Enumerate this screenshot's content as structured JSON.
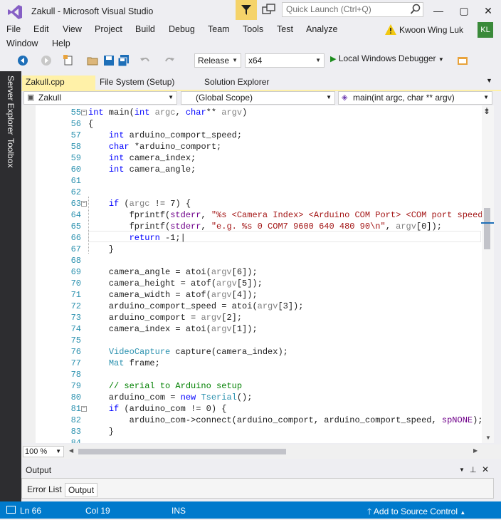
{
  "window": {
    "title": "Zakull - Microsoft Visual Studio",
    "quick_launch_placeholder": "Quick Launch (Ctrl+Q)",
    "minimize": "—",
    "maximize": "▢",
    "close": "✕"
  },
  "menu": [
    "File",
    "Edit",
    "View",
    "Project",
    "Build",
    "Debug",
    "Team",
    "Tools",
    "Test",
    "Analyze",
    "Window",
    "Help"
  ],
  "user": {
    "name": "Kwoon Wing Luk",
    "initials": "KL"
  },
  "toolbar": {
    "configuration": "Release",
    "platform": "x64",
    "debugger": "Local Windows Debugger"
  },
  "side_tabs": {
    "server_explorer": "Server Explorer",
    "toolbox": "Toolbox"
  },
  "tabs": [
    "Zakull.cpp",
    "File System (Setup)",
    "Solution Explorer"
  ],
  "nav": {
    "project": "Zakull",
    "scope": "(Global Scope)",
    "member": "main(int argc, char ** argv)"
  },
  "code_lines": [
    {
      "n": "55",
      "fold": "−",
      "html": "<span class=\"kw\">int</span> main(<span class=\"kw\">int</span> <span class=\"pm\">argc</span>, <span class=\"kw\">char</span>** <span class=\"pm\">argv</span>)"
    },
    {
      "n": "56",
      "fold": "",
      "html": "{"
    },
    {
      "n": "57",
      "fold": "",
      "html": "    <span class=\"kw\">int</span> arduino_comport_speed;"
    },
    {
      "n": "58",
      "fold": "",
      "html": "    <span class=\"kw\">char</span> *arduino_comport;"
    },
    {
      "n": "59",
      "fold": "",
      "html": "    <span class=\"kw\">int</span> camera_index;"
    },
    {
      "n": "60",
      "fold": "",
      "html": "    <span class=\"kw\">int</span> camera_angle;"
    },
    {
      "n": "61",
      "fold": "",
      "html": ""
    },
    {
      "n": "62",
      "fold": "",
      "html": ""
    },
    {
      "n": "63",
      "fold": "−",
      "html": "    <span class=\"kw\">if</span> (<span class=\"pm\">argc</span> != 7) {"
    },
    {
      "n": "64",
      "fold": "",
      "html": "        fprintf(<span class=\"mc\">stderr</span>, <span class=\"st\">\"%s &lt;Camera Index&gt; &lt;Arduino COM Port&gt; &lt;COM port speed&gt;</span>"
    },
    {
      "n": "65",
      "fold": "",
      "html": "        fprintf(<span class=\"mc\">stderr</span>, <span class=\"st\">\"e.g. %s 0 COM7 9600 640 480 90\\n\"</span>, <span class=\"pm\">argv</span>[0]);"
    },
    {
      "n": "66",
      "fold": "",
      "html": "        <span class=\"kw\">return</span> -1;|"
    },
    {
      "n": "67",
      "fold": "",
      "html": "    }"
    },
    {
      "n": "68",
      "fold": "",
      "html": ""
    },
    {
      "n": "69",
      "fold": "",
      "html": "    camera_angle = atoi(<span class=\"pm\">argv</span>[6]);"
    },
    {
      "n": "70",
      "fold": "",
      "html": "    camera_height = atof(<span class=\"pm\">argv</span>[5]);"
    },
    {
      "n": "71",
      "fold": "",
      "html": "    camera_width = atof(<span class=\"pm\">argv</span>[4]);"
    },
    {
      "n": "72",
      "fold": "",
      "html": "    arduino_comport_speed = atoi(<span class=\"pm\">argv</span>[3]);"
    },
    {
      "n": "73",
      "fold": "",
      "html": "    arduino_comport = <span class=\"pm\">argv</span>[2];"
    },
    {
      "n": "74",
      "fold": "",
      "html": "    camera_index = atoi(<span class=\"pm\">argv</span>[1]);"
    },
    {
      "n": "75",
      "fold": "",
      "html": ""
    },
    {
      "n": "76",
      "fold": "",
      "html": "    <span class=\"ty\">VideoCapture</span> capture(camera_index);"
    },
    {
      "n": "77",
      "fold": "",
      "html": "    <span class=\"ty\">Mat</span> frame;"
    },
    {
      "n": "78",
      "fold": "",
      "html": ""
    },
    {
      "n": "79",
      "fold": "",
      "html": "    <span class=\"cm\">// serial to Arduino setup</span>"
    },
    {
      "n": "80",
      "fold": "",
      "html": "    arduino_com = <span class=\"kw\">new</span> <span class=\"ty\">Tserial</span>();"
    },
    {
      "n": "81",
      "fold": "−",
      "html": "    <span class=\"kw\">if</span> (arduino_com != 0) {"
    },
    {
      "n": "82",
      "fold": "",
      "html": "        arduino_com-&gt;connect(arduino_comport, arduino_comport_speed, <span class=\"mc\">spNONE</span>);"
    },
    {
      "n": "83",
      "fold": "",
      "html": "    }"
    },
    {
      "n": "84",
      "fold": "",
      "html": ""
    }
  ],
  "zoom": "100 %",
  "output": {
    "title": "Output",
    "tabs": [
      "Error List",
      "Output"
    ]
  },
  "status": {
    "line": "Ln 66",
    "col": "Col 19",
    "mode": "INS",
    "source_control": "Add to Source Control"
  },
  "colors": {
    "accent": "#007acc",
    "active_tab": "#fff1a8",
    "dark_strip": "#2d2d30"
  }
}
